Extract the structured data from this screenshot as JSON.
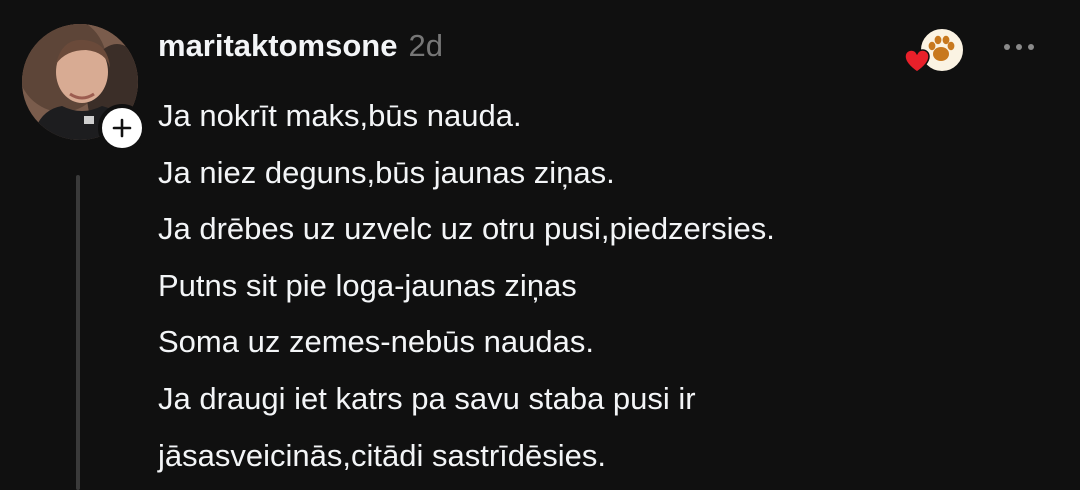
{
  "post": {
    "username": "maritaktomsone",
    "timestamp": "2d",
    "lines": [
      "Ja nokrīt maks,būs nauda.",
      "Ja niez deguns,būs jaunas ziņas.",
      "Ja drēbes uz uzvelc uz otru pusi,piedzersies.",
      "Putns sit pie loga-jaunas ziņas",
      "Soma uz zemes-nebūs naudas.",
      "Ja draugi iet katrs pa savu staba pusi ir",
      "jāsasveicinās,citādi sastrīdēsies."
    ]
  },
  "icons": {
    "follow": "plus-icon",
    "more": "more-horizontal-icon",
    "reaction_primary": "paw-print-icon",
    "reaction_secondary": "heart-icon"
  },
  "colors": {
    "background": "#101010",
    "text": "#f3f5f7",
    "muted": "#777777",
    "heart": "#e8202a",
    "thread_line": "#3a3a3a"
  }
}
